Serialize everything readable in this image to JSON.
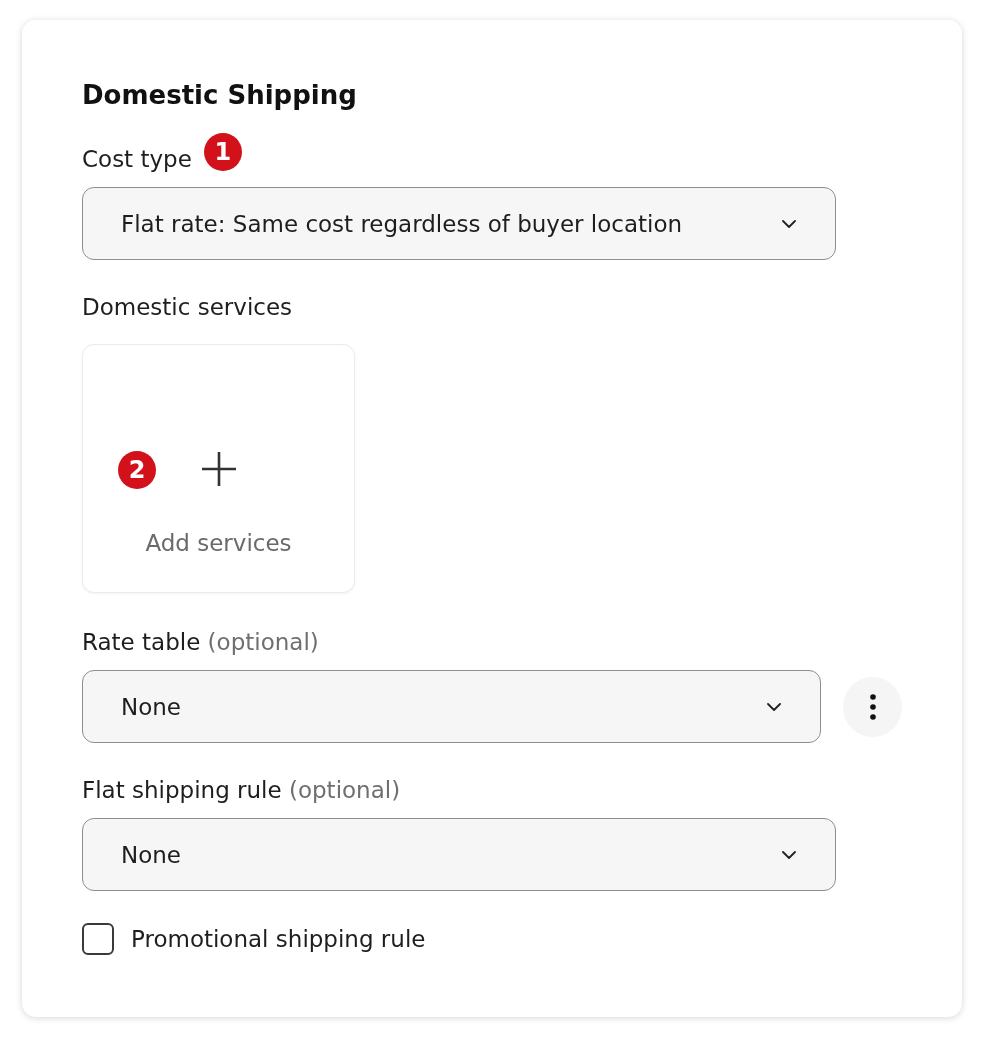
{
  "section": {
    "title": "Domestic Shipping"
  },
  "fields": [
    {
      "kind": "select",
      "label": "Cost type",
      "badge": "1",
      "value": "Flat rate: Same cost regardless of buyer location"
    },
    {
      "kind": "tile",
      "label": "Domestic services",
      "badge": "2",
      "action": "Add services"
    },
    {
      "kind": "select",
      "label": "Rate table",
      "hint": "(optional)",
      "value": "None",
      "menu_button": true
    },
    {
      "kind": "select",
      "label": "Flat shipping rule",
      "hint": "(optional)",
      "value": "None"
    },
    {
      "kind": "checkbox",
      "label": "Promotional shipping rule",
      "checked": false
    }
  ]
}
